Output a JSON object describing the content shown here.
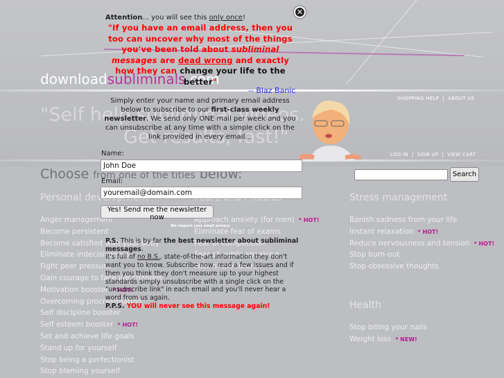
{
  "header": {
    "logo_prefix": "download",
    "logo_main": "subliminals",
    "logo_suffix": ".com",
    "slogan_line1": "\"Self help subliminal videos.",
    "slogan_line2": "Get results, fast!\"",
    "top_links": [
      "SHOPPING HELP",
      "ABOUT US"
    ],
    "account_links": [
      "LOG IN",
      "SIGN UP",
      "VIEW CART"
    ],
    "separator": "|"
  },
  "search": {
    "placeholder": "",
    "button_label": "Search"
  },
  "main": {
    "choose_big": "Choose",
    "choose_small": "from one of the titles",
    "choose_end": "below:",
    "categories": [
      {
        "title": "Personal development",
        "items": [
          {
            "label": "Anger management"
          },
          {
            "label": "Become persistent"
          },
          {
            "label": "Become satisfied with your body"
          },
          {
            "label": "Eliminate indecisiveness"
          },
          {
            "label": "Fight peer pressure"
          },
          {
            "label": "Gain courage to face life changes"
          },
          {
            "label": "Motivation booster",
            "badge": "* HOT!"
          },
          {
            "label": "Overcoming procrastination"
          },
          {
            "label": "Self discipline booster"
          },
          {
            "label": "Self esteem booster",
            "badge": "* HOT!"
          },
          {
            "label": "Set and achieve life goals"
          },
          {
            "label": "Stand up for yourself"
          },
          {
            "label": "Stop being a perfectionist"
          },
          {
            "label": "Stop blaming yourself"
          }
        ]
      },
      {
        "title": "Fears and Phobias",
        "items": [
          {
            "label": "Approach anxiety (for men)",
            "badge": "* HOT!"
          },
          {
            "label": "Eliminate fear of exams"
          },
          {
            "label": "Fear of competition"
          },
          {
            "label": "Fear of public speaking"
          },
          {
            "label": "Fear of the future"
          }
        ]
      },
      {
        "title": "Stress management",
        "items": [
          {
            "label": "Banish sadness from your life"
          },
          {
            "label": "Instant relaxation",
            "badge": "* HOT!"
          },
          {
            "label": "Reduce nervousness and tension",
            "badge": "* HOT!"
          },
          {
            "label": "Stop burn-out"
          },
          {
            "label": "Stop obsessive thoughts"
          }
        ]
      },
      {
        "title": "Health",
        "items": [
          {
            "label": "Stop biting your nails"
          },
          {
            "label": "Weight loss",
            "badge": "* NEW!"
          }
        ]
      }
    ]
  },
  "popup": {
    "attention_bold": "Attention",
    "attention_text": "... you will see this ",
    "attention_underline": "only once",
    "attention_end": "!",
    "quote_1": "\"If you have an email address, then you too can uncover why most of the things you've been told about ",
    "quote_italic_1": "subliminal messages",
    "quote_2": " are ",
    "quote_underline": "dead wrong",
    "quote_3": " and exactly how they can ",
    "quote_black": "change your life to the better",
    "quote_end": "\"",
    "author": "-- Blaz Banic",
    "intro_1": "Simply enter your name and primary email address below to subscribe to our ",
    "intro_bold": "first-class weekly newsletter",
    "intro_2": ". We send only ONE mail per week and you can unsubscribe at any time with a simple click on the link provided in every email...",
    "name_label": "Name:",
    "name_value": "John Doe",
    "email_label": "Email:",
    "email_value": "youremail@domain.com",
    "submit_label": "Yes! Send me the newsletter now",
    "privacy_note": "We respect your email privacy",
    "ps_label": "P.S.",
    "ps_1": " This is by far ",
    "ps_bold": "the best newsletter about subliminal messages",
    "ps_2": ".",
    "ps_3": "It's full of ",
    "ps_underline": "no B.S.",
    "ps_4": ", state-of-the-art information they don't want you to know. Subscribe now, read a few issues and if then you think they don't measure up to your highest standards simply unsubscribe with a single click on the \"unsubscribe link\" in each email and you'll never hear a word from us again.",
    "pps_label": "P.P.S.",
    "pps_text": " YOU will never see this message again!",
    "close_icon": "close-x-icon"
  },
  "colors": {
    "background": "#bdbec2",
    "brand": "#b2359a",
    "badge": "#b01e8f",
    "quote": "#ff0000",
    "author": "#2d2de0"
  }
}
